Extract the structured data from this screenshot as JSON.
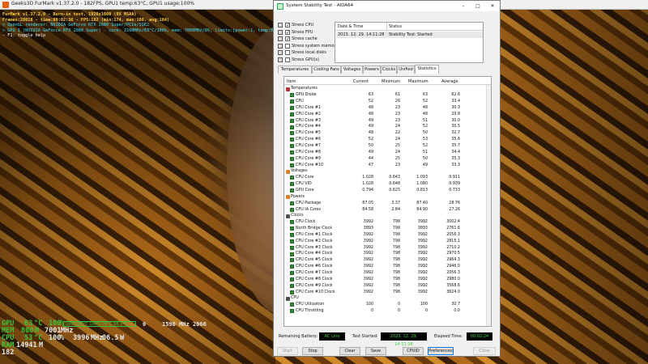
{
  "furmark": {
    "title": "Geeks3D FurMark v1.37.2.0 - 182FPS, GPU1 temp:63°C, GPU1 usage:100%",
    "osd": [
      "FurMark v1.37.2.0 - Burn-in test, 1920x1080 (0X MSAA)",
      "Frames:28018 - time:00:02:36 - FPS:182 (min:174, max:188, avg:184)",
      "> OpenGL renderer: NVIDIA GeForce RTX 2080 Super/PCIe/SSE2",
      "> GPU 1 (NVIDIA GeForce RTX 2080 Super) - core: 1590MHz/63°C/100%, mem: 7000MHz/8%, limits:[power:1, temp:0, volt:0, OV:0]",
      "- F1: toggle help"
    ]
  },
  "monitor": {
    "rows": [
      {
        "label": "GPU",
        "v1": "63",
        "u1": "°C",
        "v2": "100",
        "u2": "%"
      },
      {
        "label": "MEM",
        "v1": "800",
        "u1": "M",
        "v2": "7001",
        "u2": "MHz"
      },
      {
        "label": "CPU",
        "v1": "53",
        "u1": "°C",
        "v2": "100",
        "u2": "%",
        "v3": "3996",
        "u3": "MHz",
        "v4": "06.5",
        "u4": "W"
      },
      {
        "label": "RAM",
        "v1": "14941",
        "u1": "M"
      },
      {
        "label": "",
        "v1": "182",
        "u1": ""
      }
    ],
    "graph_text": "GPU1:63°C  100%  78°C  98   1°C",
    "gpu_clock": "1590",
    "gpu_clock_unit": "MHz",
    "gpu_clock_extra": "2066",
    "zero": "0"
  },
  "aida": {
    "title": "System Stability Test - AIDA64",
    "window_buttons": [
      "–",
      "□",
      "✕"
    ],
    "stress_options": [
      {
        "label": "Stress CPU",
        "checked": true
      },
      {
        "label": "Stress FPU",
        "checked": true
      },
      {
        "label": "Stress cache",
        "checked": true
      },
      {
        "label": "Stress system memory",
        "checked": false
      },
      {
        "label": "Stress local disks",
        "checked": false
      },
      {
        "label": "Stress GPU(s)",
        "checked": false
      }
    ],
    "check_mark": "✓",
    "log": {
      "col1": "Date & Time",
      "col2": "Status",
      "rows": [
        {
          "datetime": "2023. 12. 29. 14:11:28",
          "status": "Stability Test: Started"
        }
      ]
    },
    "tabs": [
      "Temperatures",
      "Cooling Fans",
      "Voltages",
      "Powers",
      "Clocks",
      "Unified",
      "Statistics"
    ],
    "active_tab": "Statistics",
    "stats_headers": {
      "item": "Item",
      "current": "Current",
      "minimum": "Minimum",
      "maximum": "Maximum",
      "average": "Average"
    },
    "stats": [
      {
        "kind": "group",
        "name": "Temperatures",
        "icon": "thermometer-icon"
      },
      {
        "kind": "row",
        "name": "GPU Diode",
        "cur": "63",
        "min": "61",
        "max": "63",
        "avg": "62.6"
      },
      {
        "kind": "row",
        "name": "CPU",
        "cur": "52",
        "min": "26",
        "max": "52",
        "avg": "33.4"
      },
      {
        "kind": "row",
        "name": "CPU Core #1",
        "cur": "48",
        "min": "23",
        "max": "48",
        "avg": "30.3"
      },
      {
        "kind": "row",
        "name": "CPU Core #2",
        "cur": "48",
        "min": "23",
        "max": "48",
        "avg": "29.8"
      },
      {
        "kind": "row",
        "name": "CPU Core #3",
        "cur": "49",
        "min": "23",
        "max": "51",
        "avg": "30.0"
      },
      {
        "kind": "row",
        "name": "CPU Core #4",
        "cur": "49",
        "min": "24",
        "max": "52",
        "avg": "30.5"
      },
      {
        "kind": "row",
        "name": "CPU Core #5",
        "cur": "48",
        "min": "22",
        "max": "50",
        "avg": "32.7"
      },
      {
        "kind": "row",
        "name": "CPU Core #6",
        "cur": "52",
        "min": "24",
        "max": "53",
        "avg": "35.6"
      },
      {
        "kind": "row",
        "name": "CPU Core #7",
        "cur": "50",
        "min": "25",
        "max": "52",
        "avg": "35.7"
      },
      {
        "kind": "row",
        "name": "CPU Core #8",
        "cur": "49",
        "min": "24",
        "max": "51",
        "avg": "34.4"
      },
      {
        "kind": "row",
        "name": "CPU Core #9",
        "cur": "44",
        "min": "25",
        "max": "50",
        "avg": "35.3"
      },
      {
        "kind": "row",
        "name": "CPU Core #10",
        "cur": "47",
        "min": "23",
        "max": "49",
        "avg": "33.3"
      },
      {
        "kind": "group",
        "name": "Voltages",
        "icon": "voltage-icon"
      },
      {
        "kind": "row",
        "name": "CPU Core",
        "cur": "1.028",
        "min": "0.643",
        "max": "1.093",
        "avg": "0.911"
      },
      {
        "kind": "row",
        "name": "CPU VID",
        "cur": "1.028",
        "min": "0.648",
        "max": "1.080",
        "avg": "0.939"
      },
      {
        "kind": "row",
        "name": "GPU Core",
        "cur": "0.794",
        "min": "0.625",
        "max": "0.813",
        "avg": "0.733"
      },
      {
        "kind": "group",
        "name": "Powers",
        "icon": "power-icon"
      },
      {
        "kind": "row",
        "name": "CPU Package",
        "cur": "87.05",
        "min": "3.37",
        "max": "87.40",
        "avg": "28.76"
      },
      {
        "kind": "row",
        "name": "CPU IA Cores",
        "cur": "84.58",
        "min": "2.84",
        "max": "84.90",
        "avg": "27.26"
      },
      {
        "kind": "group",
        "name": "Clocks",
        "icon": "clock-icon"
      },
      {
        "kind": "row",
        "name": "CPU Clock",
        "cur": "3992",
        "min": "798",
        "max": "3992",
        "avg": "3002.4"
      },
      {
        "kind": "row",
        "name": "North Bridge Clock",
        "cur": "3893",
        "min": "798",
        "max": "3893",
        "avg": "2761.6"
      },
      {
        "kind": "row",
        "name": "CPU Core #1 Clock",
        "cur": "3992",
        "min": "798",
        "max": "3992",
        "avg": "2056.3"
      },
      {
        "kind": "row",
        "name": "CPU Core #2 Clock",
        "cur": "3992",
        "min": "798",
        "max": "3992",
        "avg": "2815.1"
      },
      {
        "kind": "row",
        "name": "CPU Core #3 Clock",
        "cur": "3992",
        "min": "798",
        "max": "3992",
        "avg": "2710.2"
      },
      {
        "kind": "row",
        "name": "CPU Core #4 Clock",
        "cur": "3992",
        "min": "798",
        "max": "3992",
        "avg": "2970.5"
      },
      {
        "kind": "row",
        "name": "CPU Core #5 Clock",
        "cur": "3992",
        "min": "798",
        "max": "3992",
        "avg": "2964.3"
      },
      {
        "kind": "row",
        "name": "CPU Core #6 Clock",
        "cur": "3992",
        "min": "798",
        "max": "3992",
        "avg": "2946.0"
      },
      {
        "kind": "row",
        "name": "CPU Core #7 Clock",
        "cur": "3992",
        "min": "798",
        "max": "3992",
        "avg": "2056.3"
      },
      {
        "kind": "row",
        "name": "CPU Core #8 Clock",
        "cur": "3992",
        "min": "798",
        "max": "3992",
        "avg": "2980.0"
      },
      {
        "kind": "row",
        "name": "CPU Core #9 Clock",
        "cur": "3992",
        "min": "798",
        "max": "3992",
        "avg": "3568.6"
      },
      {
        "kind": "row",
        "name": "CPU Core #10 Clock",
        "cur": "3992",
        "min": "798",
        "max": "3992",
        "avg": "3624.0"
      },
      {
        "kind": "group",
        "name": "CPU",
        "icon": "cpu-icon"
      },
      {
        "kind": "row",
        "name": "CPU Utilization",
        "cur": "100",
        "min": "0",
        "max": "100",
        "avg": "30.7"
      },
      {
        "kind": "row",
        "name": "CPU Throttling",
        "cur": "0",
        "min": "0",
        "max": "0",
        "avg": "0.0"
      }
    ],
    "bottom": {
      "battery_label": "Remaining Battery:",
      "battery_value": "AC Line",
      "started_label": "Test Started:",
      "started_value": "2023. 12. 29. 14:11:28",
      "elapsed_label": "Elapsed Time:",
      "elapsed_value": "00:02:24"
    },
    "buttons": {
      "start": "Start",
      "stop": "Stop",
      "clear": "Clear",
      "save": "Save",
      "cpuid": "CPUID",
      "preferences": "Preferences",
      "close": "Close"
    }
  },
  "colors": {
    "osd_yellow": "#ffd040",
    "osd_cyan": "#40e0ff",
    "monitor_green": "#3ac43a",
    "aida_bg": "#f0f0f0",
    "lcd_green": "#3ad43a"
  }
}
